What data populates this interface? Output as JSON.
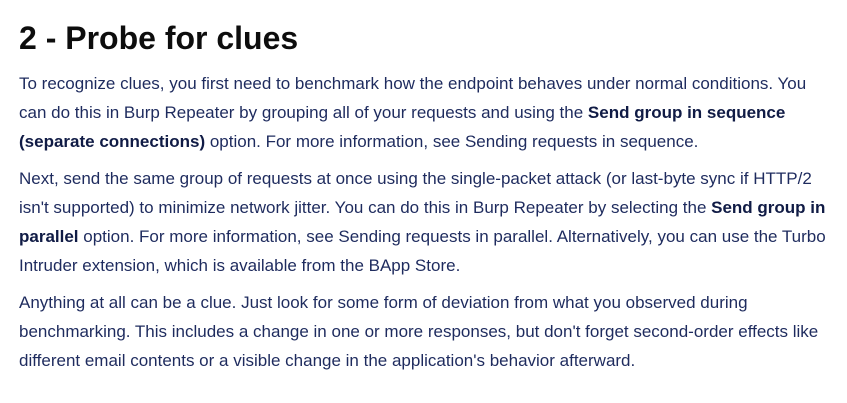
{
  "heading": "2 - Probe for clues",
  "paragraphs": [
    {
      "t1": "To recognize clues, you first need to benchmark how the endpoint behaves under normal conditions. You can do this in Burp Repeater by grouping all of your requests and using the ",
      "b1": "Send group in sequence (separate connections)",
      "t2": " option. For more information, see Sending requests in sequence."
    },
    {
      "t1": "Next, send the same group of requests at once using the single-packet attack (or last-byte sync if HTTP/2 isn't supported) to minimize network jitter. You can do this in Burp Repeater by selecting the ",
      "b1": "Send group in parallel",
      "t2": " option. For more information, see Sending requests in parallel. Alternatively, you can use the Turbo Intruder extension, which is available from the BApp Store."
    },
    {
      "t1": "Anything at all can be a clue. Just look for some form of deviation from what you observed during benchmarking. This includes a change in one or more responses, but don't forget second-order effects like different email contents or a visible change in the application's behavior afterward."
    }
  ]
}
